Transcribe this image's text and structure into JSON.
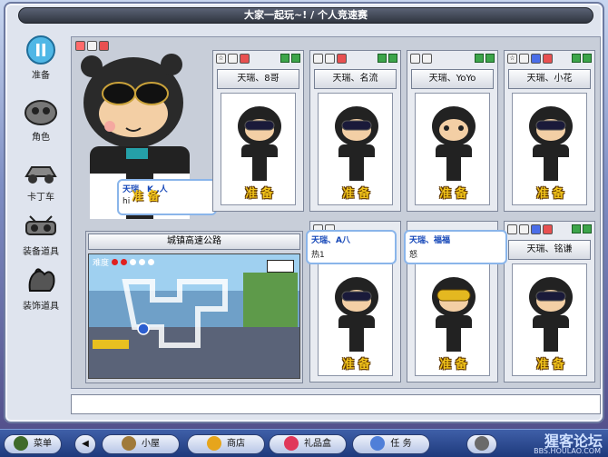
{
  "window": {
    "title": "大家一起玩~! / 个人竞速赛"
  },
  "sidebar": {
    "items": [
      {
        "label": "准备",
        "icon": "pause-icon"
      },
      {
        "label": "角色",
        "icon": "character-icon"
      },
      {
        "label": "卡丁车",
        "icon": "kart-icon"
      },
      {
        "label": "装备道具",
        "icon": "equipment-icon"
      },
      {
        "label": "装饰道具",
        "icon": "decoration-icon"
      }
    ]
  },
  "host": {
    "chat_name": "天瑞、K..人",
    "chat_overlay": "准 备",
    "chat_msg": "hi"
  },
  "slots": [
    {
      "name": "天瑞、8哥",
      "ready": "准 备",
      "goggles": "black"
    },
    {
      "name": "天瑞、名流",
      "ready": "准 备",
      "goggles": "black"
    },
    {
      "name": "天瑞、YoYo",
      "ready": "准 备",
      "goggles": "black"
    },
    {
      "name": "天瑞、小花",
      "ready": "准 备",
      "goggles": "black"
    },
    {
      "name": "",
      "ready": "准 备",
      "goggles": "black"
    },
    {
      "name": "",
      "ready": "准 备",
      "goggles": "yellow"
    },
    {
      "name": "天瑞、铭谦",
      "ready": "准 备",
      "goggles": "black"
    }
  ],
  "chat": [
    {
      "name": "天瑞、A八",
      "msg": "热1"
    },
    {
      "name": "天瑞、福福",
      "msg": "怒"
    }
  ],
  "map": {
    "title": "城镇高速公路",
    "difficulty_label": "难度",
    "difficulty_value": 2,
    "difficulty_max": 5
  },
  "taskbar": {
    "menu": "菜单",
    "home": "小屋",
    "shop": "商店",
    "gift": "礼品盒",
    "task": "任 务"
  },
  "watermark": {
    "main": "猩客论坛",
    "sub": "BBS.HOULAO.COM"
  }
}
